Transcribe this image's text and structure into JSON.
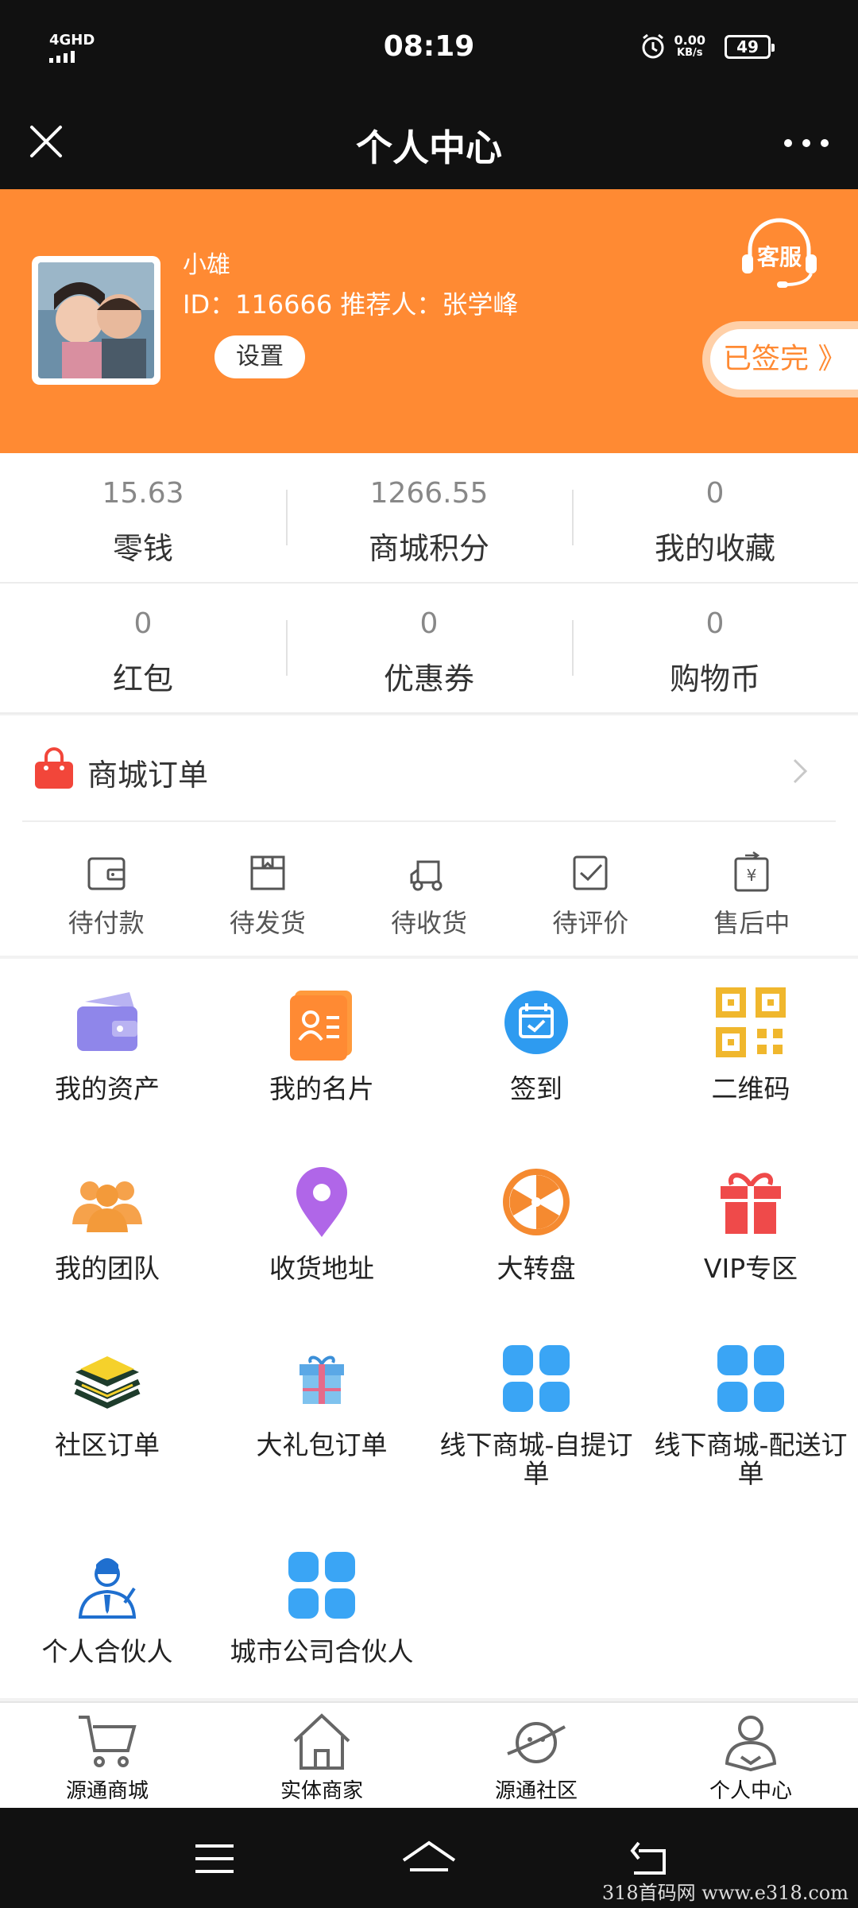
{
  "status_bar": {
    "network": "4GHD",
    "time": "08:19",
    "speed_value": "0.00",
    "speed_unit": "KB/s",
    "battery": "49"
  },
  "title_bar": {
    "title": "个人中心",
    "close_icon": "close-icon",
    "more_icon": "more-icon"
  },
  "profile": {
    "name": "小雄",
    "id_line": "ID：116666  推荐人：张学峰",
    "settings_label": "设置",
    "service_label": "客服",
    "signed_label": "已签完 》",
    "accent_color": "#ff8a33"
  },
  "stats": [
    {
      "value": "15.63",
      "label": "零钱"
    },
    {
      "value": "1266.55",
      "label": "商城积分"
    },
    {
      "value": "0",
      "label": "我的收藏"
    },
    {
      "value": "0",
      "label": "红包"
    },
    {
      "value": "0",
      "label": "优惠券"
    },
    {
      "value": "0",
      "label": "购物币"
    }
  ],
  "orders": {
    "title": "商城订单",
    "items": [
      {
        "label": "待付款",
        "icon": "wallet-icon"
      },
      {
        "label": "待发货",
        "icon": "box-icon"
      },
      {
        "label": "待收货",
        "icon": "truck-icon"
      },
      {
        "label": "待评价",
        "icon": "review-icon"
      },
      {
        "label": "售后中",
        "icon": "refund-icon"
      }
    ]
  },
  "grid": [
    {
      "label": "我的资产",
      "icon": "asset-wallet-icon"
    },
    {
      "label": "我的名片",
      "icon": "card-icon"
    },
    {
      "label": "签到",
      "icon": "checkin-icon"
    },
    {
      "label": "二维码",
      "icon": "qrcode-icon"
    },
    {
      "label": "我的团队",
      "icon": "team-icon"
    },
    {
      "label": "收货地址",
      "icon": "location-icon"
    },
    {
      "label": "大转盘",
      "icon": "wheel-icon"
    },
    {
      "label": "VIP专区",
      "icon": "gift-icon"
    },
    {
      "label": "社区订单",
      "icon": "layers-icon"
    },
    {
      "label": "大礼包订单",
      "icon": "giftbox-icon"
    },
    {
      "label": "线下商城-自提订单",
      "icon": "apps-icon"
    },
    {
      "label": "线下商城-配送订单",
      "icon": "apps-icon"
    },
    {
      "label": "个人合伙人",
      "icon": "partner-icon"
    },
    {
      "label": "城市公司合伙人",
      "icon": "apps-icon"
    }
  ],
  "tabbar": [
    {
      "label": "源通商城",
      "icon": "cart-icon"
    },
    {
      "label": "实体商家",
      "icon": "house-icon"
    },
    {
      "label": "源通社区",
      "icon": "planet-icon"
    },
    {
      "label": "个人中心",
      "icon": "person-icon"
    }
  ],
  "watermark": "318首码网  www.e318.com"
}
